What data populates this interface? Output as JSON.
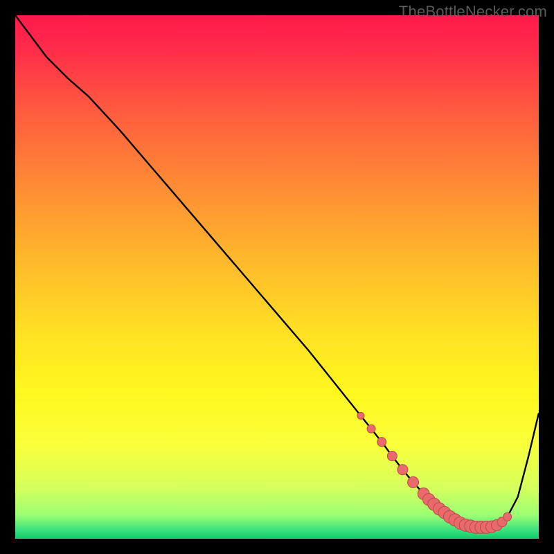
{
  "watermark": "TheBottleNecker.com",
  "colors": {
    "black": "#000000",
    "curve": "#000000",
    "marker_fill": "#e86a6a",
    "marker_stroke": "#b94b4b",
    "gradient_stops": [
      {
        "offset": 0.0,
        "color": "#ff1a4d"
      },
      {
        "offset": 0.06,
        "color": "#ff2a4a"
      },
      {
        "offset": 0.18,
        "color": "#ff5a3f"
      },
      {
        "offset": 0.32,
        "color": "#ff8a35"
      },
      {
        "offset": 0.46,
        "color": "#ffb62c"
      },
      {
        "offset": 0.6,
        "color": "#ffdf24"
      },
      {
        "offset": 0.72,
        "color": "#fff81f"
      },
      {
        "offset": 0.82,
        "color": "#f9ff3a"
      },
      {
        "offset": 0.9,
        "color": "#d7ff5c"
      },
      {
        "offset": 0.955,
        "color": "#9dff74"
      },
      {
        "offset": 0.985,
        "color": "#34e07e"
      },
      {
        "offset": 1.0,
        "color": "#13c86b"
      }
    ]
  },
  "chart_data": {
    "type": "line",
    "title": "",
    "xlabel": "",
    "ylabel": "",
    "xlim": [
      0,
      100
    ],
    "ylim": [
      0,
      100
    ],
    "grid": false,
    "series": [
      {
        "name": "bottleneck-curve",
        "x": [
          0,
          6,
          10,
          14,
          20,
          26,
          32,
          38,
          44,
          50,
          56,
          60,
          64,
          68,
          70,
          72,
          74,
          76,
          78,
          80,
          82,
          84,
          86,
          88,
          90,
          92,
          94,
          96,
          98,
          100
        ],
        "y": [
          100,
          92,
          88,
          84.5,
          78,
          71,
          64,
          57,
          50,
          43,
          36,
          31,
          26,
          21,
          18.5,
          15.8,
          13.2,
          10.8,
          8.6,
          6.6,
          5.0,
          3.6,
          2.6,
          2.2,
          2.2,
          2.6,
          4.2,
          8.0,
          15.6,
          24
        ]
      }
    ],
    "markers": {
      "name": "highlight-dots",
      "x": [
        66,
        68,
        70,
        72,
        74,
        76,
        78,
        79,
        80,
        81,
        82,
        83,
        84,
        85,
        86,
        87,
        88,
        89,
        90,
        91,
        92,
        93,
        94
      ],
      "y": [
        23.5,
        21,
        18.5,
        15.8,
        13.2,
        10.8,
        8.6,
        7.5,
        6.6,
        5.7,
        5.0,
        4.2,
        3.6,
        3.0,
        2.6,
        2.4,
        2.2,
        2.2,
        2.2,
        2.3,
        2.6,
        3.2,
        4.2
      ],
      "r": [
        5,
        6,
        6.5,
        7,
        7.5,
        8,
        8.5,
        8.7,
        9,
        9,
        9,
        9,
        9,
        9,
        9,
        9,
        9,
        9,
        9,
        8.5,
        8,
        7,
        6
      ]
    }
  }
}
